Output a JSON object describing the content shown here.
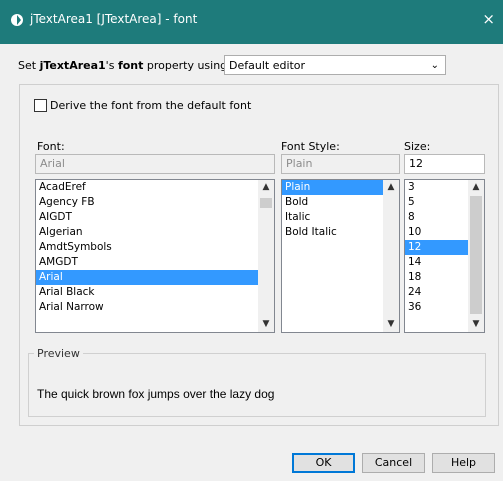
{
  "titlebar": {
    "title": "jTextArea1 [JTextArea] - font",
    "close_glyph": "×",
    "icon": "app-icon"
  },
  "property_row": {
    "prefix": "Set ",
    "component": "jTextArea1",
    "apos": "'s ",
    "property": "font",
    "suffix": " property using:",
    "editor_value": "Default editor"
  },
  "derive": {
    "checked": false,
    "label": "Derive the font from the default font"
  },
  "font": {
    "header": "Font:",
    "value": "Arial",
    "items": [
      "AcadEref",
      "Agency FB",
      "AIGDT",
      "Algerian",
      "AmdtSymbols",
      "AMGDT",
      "Arial",
      "Arial Black",
      "Arial Narrow"
    ],
    "selected_index": 6
  },
  "style": {
    "header": "Font Style:",
    "value": "Plain",
    "items": [
      "Plain",
      "Bold",
      "Italic",
      "Bold Italic"
    ],
    "selected_index": 0
  },
  "size": {
    "header": "Size:",
    "value": "12",
    "items": [
      "3",
      "5",
      "8",
      "10",
      "12",
      "14",
      "18",
      "24",
      "36"
    ],
    "selected_index": 4
  },
  "preview": {
    "title": "Preview",
    "text": "The quick brown fox jumps over the lazy dog"
  },
  "buttons": {
    "ok": "OK",
    "cancel": "Cancel",
    "help": "Help"
  },
  "colors": {
    "titlebar": "#1e7b7b",
    "selection": "#3399ff",
    "default_button_border": "#0078d7"
  }
}
